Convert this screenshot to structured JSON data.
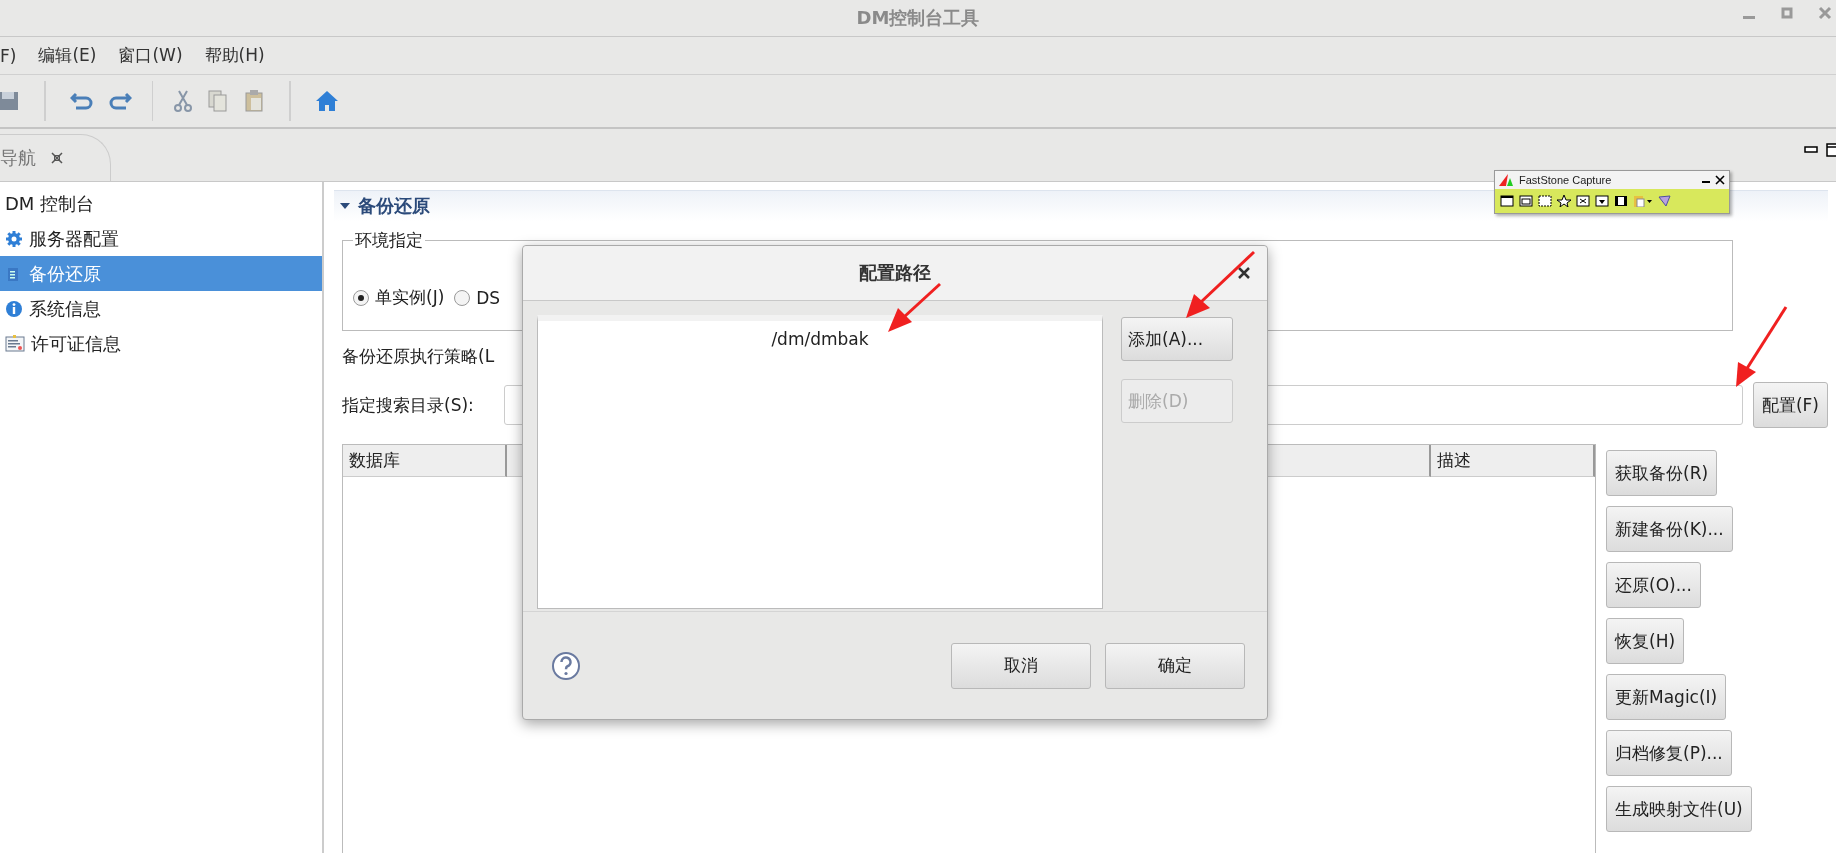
{
  "window": {
    "title": "DM控制台工具"
  },
  "menu": [
    "F)",
    "编辑(E)",
    "窗口(W)",
    "帮助(H)"
  ],
  "nav_tab": {
    "label": "导航"
  },
  "nav_tree": [
    {
      "label": "DM 控制台",
      "kind": "root",
      "selected": false
    },
    {
      "label": "服务器配置",
      "kind": "gear",
      "selected": false
    },
    {
      "label": "备份还原",
      "kind": "backup",
      "selected": true
    },
    {
      "label": "系统信息",
      "kind": "info",
      "selected": false
    },
    {
      "label": "许可证信息",
      "kind": "license",
      "selected": false
    }
  ],
  "section": {
    "title": "备份还原",
    "expanded": true
  },
  "environment": {
    "title": "环境指定",
    "options": [
      {
        "label": "单实例(J)",
        "selected": true
      },
      {
        "label": "DS",
        "selected": false
      }
    ]
  },
  "strategy_label": "备份还原执行策略(L",
  "search_dir": {
    "label": "指定搜索目录(S):",
    "button": "配置(F)"
  },
  "table": {
    "columns": [
      "数据库",
      "描述"
    ]
  },
  "actions": [
    "获取备份(R)",
    "新建备份(K)...",
    "还原(O)...",
    "恢复(H)",
    "更新Magic(I)",
    "归档修复(P)...",
    "生成映射文件(U)"
  ],
  "dialog": {
    "title": "配置路径",
    "paths": [
      {
        "text": "/dm/dmbak",
        "selected": false
      }
    ],
    "side_buttons": [
      {
        "label": "添加(A)...",
        "disabled": false
      },
      {
        "label": "删除(D)",
        "disabled": true
      }
    ],
    "footer_buttons": [
      "取消",
      "确定"
    ]
  },
  "capture_toolbar": {
    "title": "FastStone Capture"
  }
}
